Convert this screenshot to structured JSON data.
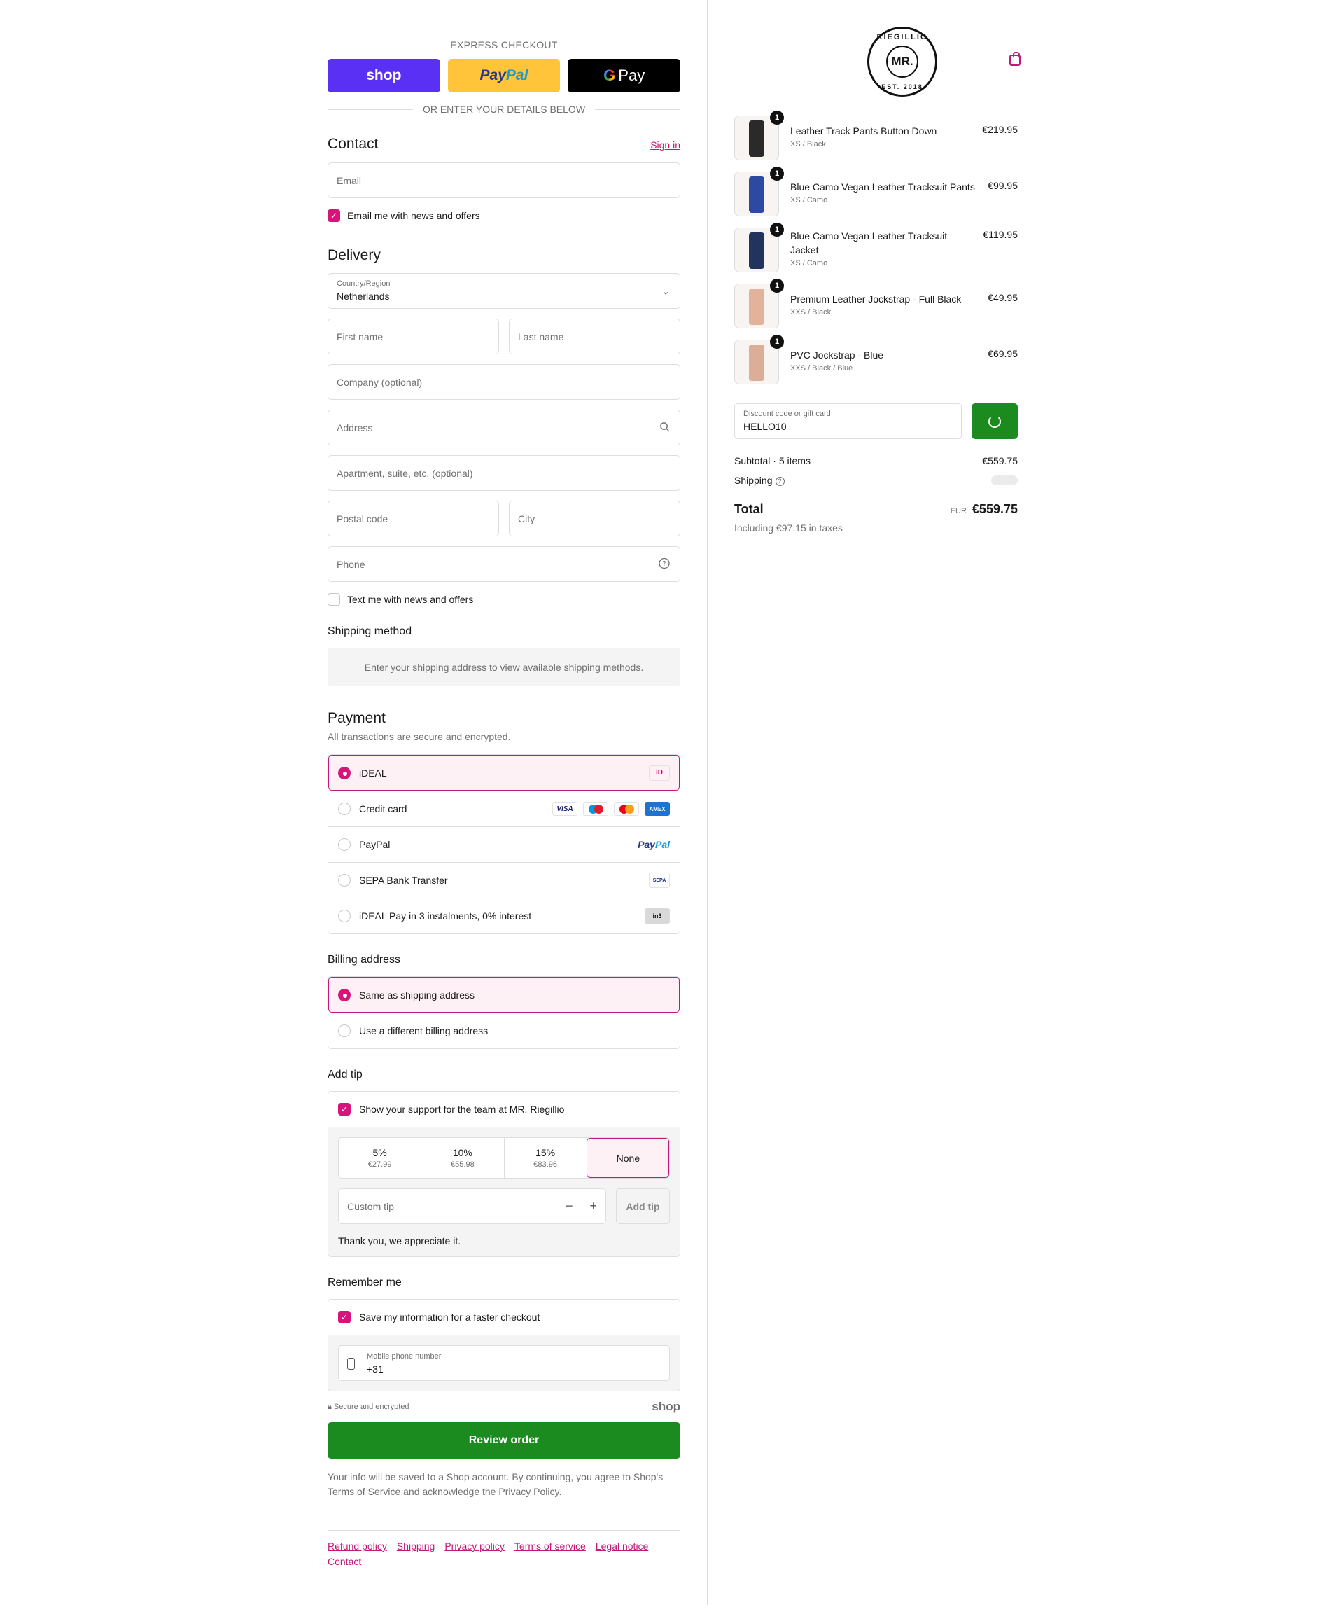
{
  "express": {
    "title": "EXPRESS CHECKOUT",
    "shop_label": "shop",
    "paypal_label_a": "Pay",
    "paypal_label_b": "Pal",
    "gpay_g": "G",
    "gpay_label": "Pay",
    "or_text": "OR ENTER YOUR DETAILS BELOW"
  },
  "contact": {
    "title": "Contact",
    "sign_in": "Sign in",
    "email_placeholder": "Email",
    "news_label": "Email me with news and offers",
    "news_checked": true
  },
  "delivery": {
    "title": "Delivery",
    "country_label": "Country/Region",
    "country_value": "Netherlands",
    "first_name": "First name",
    "last_name": "Last name",
    "company": "Company (optional)",
    "address": "Address",
    "apartment": "Apartment, suite, etc. (optional)",
    "postal": "Postal code",
    "city": "City",
    "phone": "Phone",
    "text_offers": "Text me with news and offers"
  },
  "shipping_method": {
    "title": "Shipping method",
    "message": "Enter your shipping address to view available shipping methods."
  },
  "payment": {
    "title": "Payment",
    "subtitle": "All transactions are secure and encrypted.",
    "options": [
      {
        "label": "iDEAL",
        "selected": true
      },
      {
        "label": "Credit card",
        "selected": false
      },
      {
        "label": "PayPal",
        "selected": false
      },
      {
        "label": "SEPA Bank Transfer",
        "selected": false
      },
      {
        "label": "iDEAL Pay in 3 instalments, 0% interest",
        "selected": false
      }
    ],
    "card_logos": [
      "VISA",
      "AMEX"
    ],
    "paypal_logo_a": "Pay",
    "paypal_logo_b": "Pal",
    "sepa_logo": "SEPA",
    "in3_logo": "in3"
  },
  "billing": {
    "title": "Billing address",
    "options": [
      {
        "label": "Same as shipping address",
        "selected": true
      },
      {
        "label": "Use a different billing address",
        "selected": false
      }
    ]
  },
  "tip": {
    "title": "Add tip",
    "support_label": "Show your support for the team at MR. Riegillio",
    "options": [
      {
        "pct": "5%",
        "amount": "€27.99"
      },
      {
        "pct": "10%",
        "amount": "€55.98"
      },
      {
        "pct": "15%",
        "amount": "€83.96"
      },
      {
        "pct": "None",
        "amount": ""
      }
    ],
    "custom_placeholder": "Custom tip",
    "minus": "−",
    "plus": "+",
    "add_label": "Add tip",
    "thanks": "Thank you, we appreciate it."
  },
  "remember": {
    "title": "Remember me",
    "save_label": "Save my information for a faster checkout",
    "phone_label": "Mobile phone number",
    "phone_value": "+31",
    "secure_text": "Secure and encrypted",
    "shop_word": "shop"
  },
  "review": {
    "button": "Review order",
    "legal_prefix": "Your info will be saved to a Shop account. By continuing, you agree to Shop's",
    "tos": "Terms of Service",
    "legal_mid": "and acknowledge the",
    "privacy": "Privacy Policy",
    "legal_end": "."
  },
  "footer": {
    "links": [
      "Refund policy",
      "Shipping",
      "Privacy policy",
      "Terms of service",
      "Legal notice",
      "Contact"
    ]
  },
  "brand": {
    "logo_center": "MR.",
    "logo_top": "RIEGILLIO",
    "logo_bottom": "EST. 2018"
  },
  "cart": {
    "items": [
      {
        "qty": "1",
        "name": "Leather Track Pants Button Down",
        "variant": "XS / Black",
        "price": "€219.95",
        "color": "#2a2a2a"
      },
      {
        "qty": "1",
        "name": "Blue Camo Vegan Leather Tracksuit Pants",
        "variant": "XS / Camo",
        "price": "€99.95",
        "color": "#2b4aa0"
      },
      {
        "qty": "1",
        "name": "Blue Camo Vegan Leather Tracksuit Jacket",
        "variant": "XS / Camo",
        "price": "€119.95",
        "color": "#22345e"
      },
      {
        "qty": "1",
        "name": "Premium Leather Jockstrap - Full Black",
        "variant": "XXS / Black",
        "price": "€49.95",
        "color": "#e2b39a"
      },
      {
        "qty": "1",
        "name": "PVC Jockstrap - Blue",
        "variant": "XXS / Black / Blue",
        "price": "€69.95",
        "color": "#dcae98"
      }
    ],
    "discount_label": "Discount code or gift card",
    "discount_value": "HELLO10",
    "subtotal_label": "Subtotal · 5 items",
    "subtotal_value": "€559.75",
    "shipping_label": "Shipping",
    "total_label": "Total",
    "currency": "EUR",
    "total_value": "€559.75",
    "taxes": "Including €97.15 in taxes"
  },
  "colors": {
    "accent": "#c2187a",
    "primary_button": "#1b8a1f",
    "shop_purple": "#5a31f4",
    "paypal_yellow": "#ffc439"
  }
}
